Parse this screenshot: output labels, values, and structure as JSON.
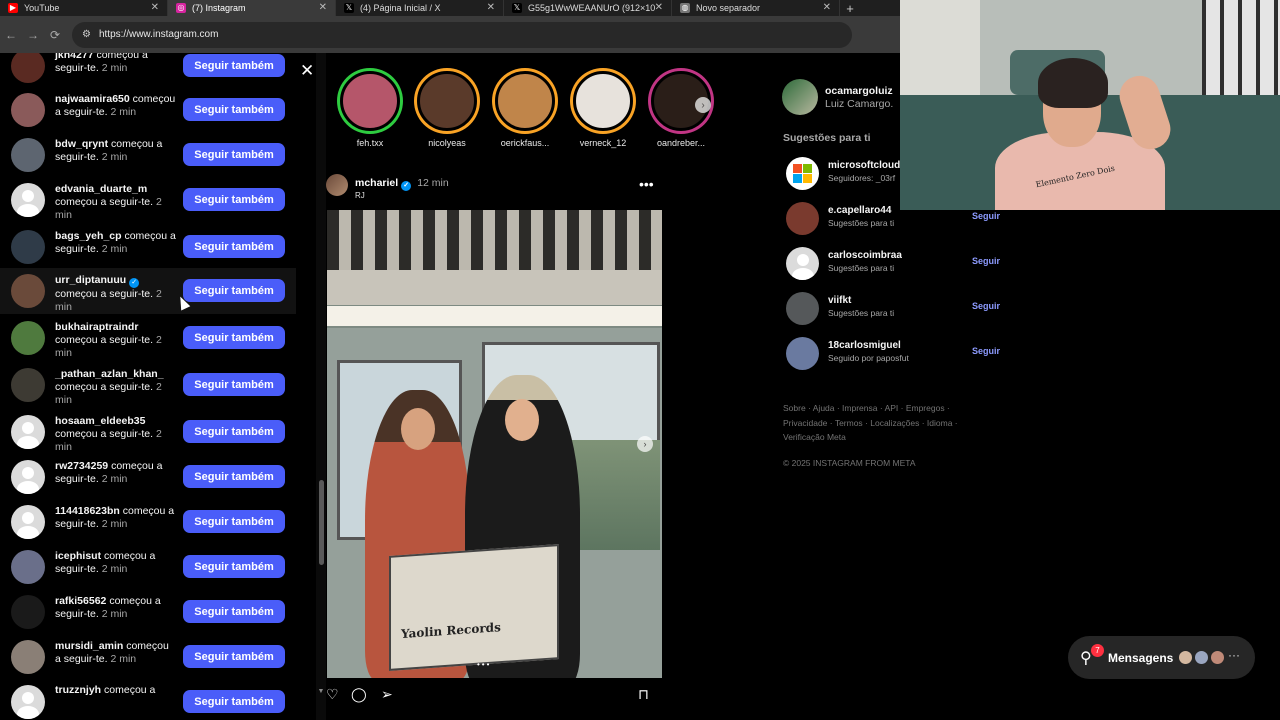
{
  "browser": {
    "tabs": [
      {
        "title": "YouTube",
        "icon": "youtube-icon",
        "color": "#ff0000",
        "glyph": "▶",
        "close": "✕"
      },
      {
        "title": "(7) Instagram",
        "icon": "instagram-icon",
        "color": "#d6249f",
        "glyph": "◎",
        "close": "✕"
      },
      {
        "title": "(4) Página Inicial / X",
        "icon": "x-icon",
        "color": "#000000",
        "glyph": "𝕏",
        "close": "✕"
      },
      {
        "title": "G55g1WwWEAANUrO (912×10",
        "icon": "x-icon",
        "color": "#000000",
        "glyph": "𝕏",
        "close": "✕"
      },
      {
        "title": "Novo separador",
        "icon": "globe-icon",
        "color": "#777777",
        "glyph": "◍",
        "close": "✕"
      }
    ],
    "new_tab": "+",
    "url": "https://www.instagram.com"
  },
  "notifications": {
    "close": "✕",
    "action_label": "Seguir também",
    "items": [
      {
        "user": "jkn4277",
        "text": "começou a seguir-te.",
        "time": "2 min",
        "avatar": "#5a2a22"
      },
      {
        "user": "najwaamira650",
        "text": "começou a seguir-te.",
        "time": "2 min",
        "avatar": "#8a5a5a"
      },
      {
        "user": "bdw_qrynt",
        "text": "começou a seguir-te.",
        "time": "2 min",
        "avatar": "#5d6570"
      },
      {
        "user": "edvania_duarte_m",
        "text": "começou a seguir-te.",
        "time": "2 min",
        "avatar": "default"
      },
      {
        "user": "bags_yeh_cp",
        "text": "começou a seguir-te.",
        "time": "2 min",
        "avatar": "#2f3b48"
      },
      {
        "user": "urr_diptanuuu",
        "text": "começou a seguir-te.",
        "time": "2 min",
        "avatar": "#6a4a3a",
        "verified": true
      },
      {
        "user": "bukhairaptraindr",
        "text": "começou a seguir-te.",
        "time": "2 min",
        "avatar": "#4f7a3e"
      },
      {
        "user": "_pathan_azlan_khan_",
        "text": "começou a seguir-te.",
        "time": "2 min",
        "avatar": "#3d3a33"
      },
      {
        "user": "hosaam_eldeeb35",
        "text": "começou a seguir-te.",
        "time": "2 min",
        "avatar": "default"
      },
      {
        "user": "rw2734259",
        "text": "começou a seguir-te.",
        "time": "2 min",
        "avatar": "default"
      },
      {
        "user": "114418623bn",
        "text": "começou a seguir-te.",
        "time": "2 min",
        "avatar": "default"
      },
      {
        "user": "icephisut",
        "text": "começou a seguir-te.",
        "time": "2 min",
        "avatar": "#6a6f8a"
      },
      {
        "user": "rafki56562",
        "text": "começou a seguir-te.",
        "time": "2 min",
        "avatar": "#1a1a1a"
      },
      {
        "user": "mursidi_amin",
        "text": "começou a seguir-te.",
        "time": "2 min",
        "avatar": "#8a7f76"
      },
      {
        "user": "truzznjyh",
        "text": "começou a",
        "time": "",
        "avatar": "default"
      }
    ]
  },
  "stories": [
    {
      "name": "feh.txx",
      "ring": "#2ecc40",
      "photo": "#b5566a"
    },
    {
      "name": "nicolyeas",
      "ring": "#f9a325",
      "photo": "#5a3a2a"
    },
    {
      "name": "oerickfaus...",
      "ring": "#f9a325",
      "photo": "#c0854a"
    },
    {
      "name": "verneck_12",
      "ring": "#f9a325",
      "photo": "#e7e2dc"
    },
    {
      "name": "oandreber...",
      "ring": "#c13584",
      "photo": "#2a1e18"
    }
  ],
  "stories_next": "›",
  "post": {
    "user": "mchariel",
    "verified_mark": "✓",
    "time": "12 min",
    "location": "RJ",
    "more": "•••",
    "photo_text": "Yaolin Records",
    "dots": "•••",
    "next": "›"
  },
  "post_actions": {
    "like": "♡",
    "comment": "◯",
    "share": "➢",
    "save": "⊓"
  },
  "profile": {
    "username": "ocamargoluiz",
    "name": "Luiz Camargo."
  },
  "suggestions": {
    "title": "Sugestões para ti",
    "follow_label": "Seguir",
    "items": [
      {
        "user": "microsoftcloud",
        "sub": "Seguidores: _03rf",
        "avatar": "microsoft",
        "show_follow": false
      },
      {
        "user": "e.capellaro44",
        "sub": "Sugestões para ti",
        "avatar": "#7a3a2e",
        "show_follow": true
      },
      {
        "user": "carloscoimbraa",
        "sub": "Sugestões para ti",
        "avatar": "default",
        "show_follow": true
      },
      {
        "user": "viifkt",
        "sub": "Sugestões para ti",
        "avatar": "#55585a",
        "show_follow": true
      },
      {
        "user": "18carlosmiguel",
        "sub": "Seguido por paposfut",
        "avatar": "#6a7aa0",
        "show_follow": true
      }
    ]
  },
  "footer": {
    "links": "Sobre · Ajuda · Imprensa · API · Empregos · Privacidade · Termos · Localizações · Idioma · Verificação Meta",
    "copyright": "© 2025 INSTAGRAM FROM META"
  },
  "messages": {
    "label": "Mensagens",
    "badge": "7",
    "icon": "⚲",
    "more": "···",
    "avatars": [
      "#d4b8a0",
      "#9aa6c0",
      "#c08a78"
    ]
  },
  "webcam": {
    "shirt_text": "Elemento Zero Dois"
  },
  "colors": {
    "accent": "#4a5df9",
    "link": "#8d9bff",
    "badge": "#ff3040",
    "background": "#000000"
  }
}
